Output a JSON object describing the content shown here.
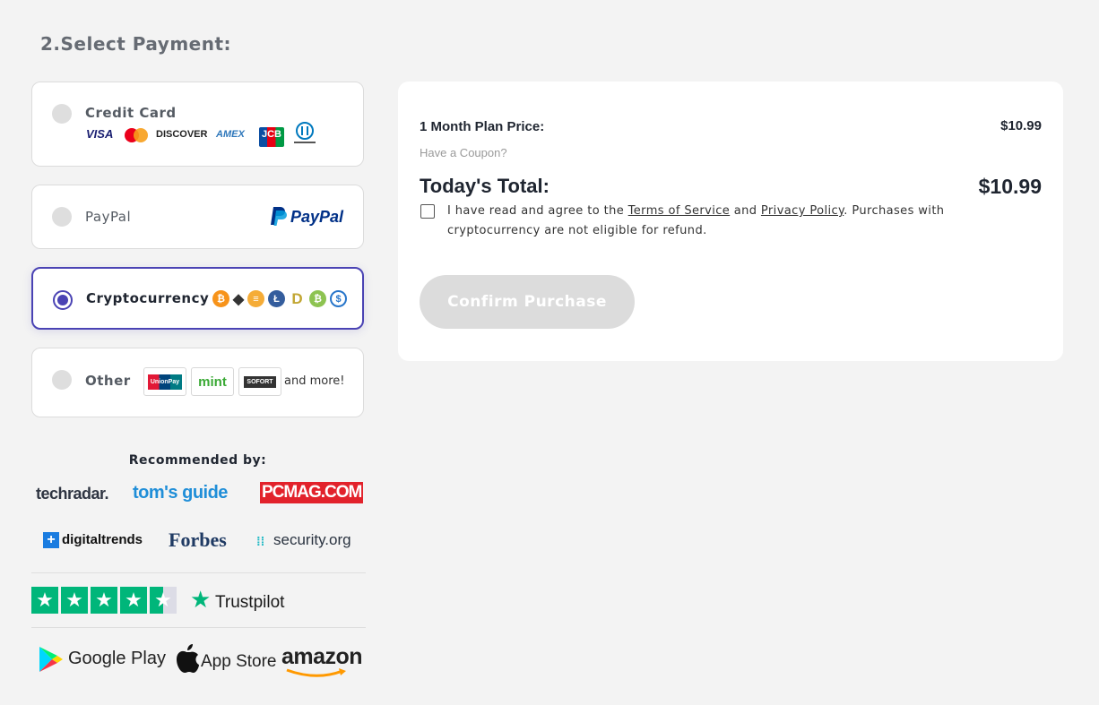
{
  "section_title": "2.Select Payment:",
  "payment_methods": {
    "credit_card": {
      "label": "Credit Card",
      "brands": [
        "VISA",
        "DISCOVER",
        "AMEX",
        "JCB",
        "Diners Club"
      ]
    },
    "paypal": {
      "label": "PayPal",
      "logo_text": "PayPal"
    },
    "crypto": {
      "label": "Cryptocurrency",
      "selected": true
    },
    "other": {
      "label": "Other",
      "brands": [
        "UnionPay",
        "mint",
        "SOFORT"
      ],
      "more": "and more!"
    }
  },
  "summary": {
    "plan_label": "1 Month Plan Price:",
    "plan_price": "$10.99",
    "coupon_link": "Have a Coupon?",
    "total_label": "Today's Total:",
    "total_price": "$10.99",
    "terms_pre": "I have read and agree to the ",
    "terms_link": "Terms of Service",
    "terms_and": " and ",
    "privacy_link": "Privacy Policy",
    "terms_post": ". Purchases with cryptocurrency are not eligible for refund.",
    "confirm_label": "Confirm Purchase"
  },
  "recommended": {
    "title": "Recommended by:",
    "outlets": [
      "techradar.",
      "tom's guide",
      "PCMAG.COM",
      "digitaltrends",
      "Forbes",
      "security.org"
    ]
  },
  "trustpilot": {
    "label": "Trustpilot",
    "rating_stars": 4.5
  },
  "stores": [
    "Google Play",
    "App Store",
    "amazon"
  ],
  "colors": {
    "accent": "#4a43b4",
    "trustpilot": "#00b67a",
    "button_disabled": "#dcdcdc"
  }
}
